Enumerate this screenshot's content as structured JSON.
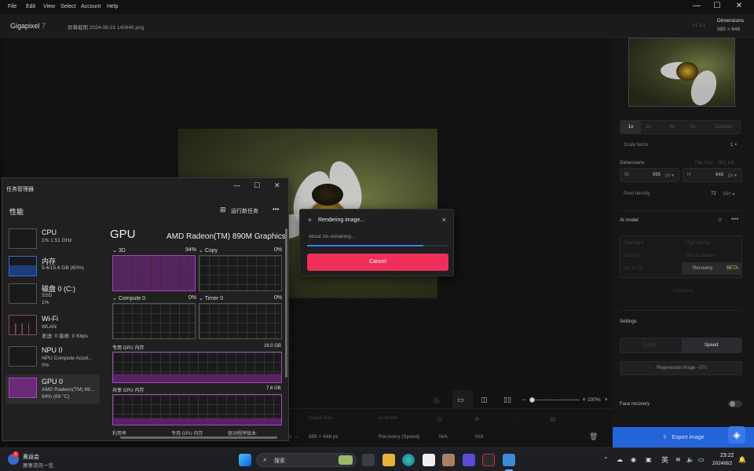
{
  "menu": [
    "File",
    "Edit",
    "View",
    "Select",
    "Account",
    "Help"
  ],
  "app": {
    "name": "Gigapixel",
    "version": "7",
    "filename": "屏幕截图 2024-08-01 140640.png",
    "build": "v7.3.1",
    "dimensions_label": "Dimensions",
    "dimensions_value": "995 × 648"
  },
  "scale": {
    "options": [
      "1x",
      "2x",
      "4x",
      "6x",
      "Custom"
    ],
    "factor_label": "Scale factor",
    "factor_value": "1 ×"
  },
  "dims": {
    "label": "Dimensions",
    "file_size": "File Size: ~991 KB",
    "w_label": "W",
    "w_value": "995",
    "w_unit": "px ▾",
    "h_label": "H",
    "h_value": "648",
    "h_unit": "px ▾",
    "density_label": "Pixel density",
    "density_value": "72",
    "density_unit": "PPI ▾"
  },
  "ai": {
    "label": "AI model",
    "models": [
      "Standard",
      "High fidelity",
      "Low res",
      "Text & shapes",
      "Art & CG",
      "Recovery"
    ],
    "badge": "BETA",
    "compare": "Compare"
  },
  "settings": {
    "label": "Settings",
    "quality": "Quality",
    "speed": "Speed",
    "regen": "Regenerate image ~57s",
    "face": "Face recovery"
  },
  "export": {
    "label": "Export image"
  },
  "zoom": "100%",
  "table": {
    "headers": [
      "Output Size",
      "AI Model"
    ],
    "in": "995 × 648 px",
    "sep": "x →",
    "out": "995 × 648 px",
    "model": "Recovery (Speed)",
    "na1": "N/A",
    "na2": "N/A"
  },
  "render": {
    "title": "Rendering image...",
    "remaining": "About 1m remaining...",
    "cancel": "Cancel",
    "progress": 0.82
  },
  "taskmgr": {
    "title": "任务管理器",
    "perf": "性能",
    "run": "运行新任务",
    "items": [
      {
        "name": "CPU",
        "sub1": "1%  1.51 GHz",
        "sub2": ""
      },
      {
        "name": "内存",
        "sub1": "9.4/15.6 GB (60%)",
        "sub2": ""
      },
      {
        "name": "磁盘 0 (C:)",
        "sub1": "SSD",
        "sub2": "1%"
      },
      {
        "name": "Wi-Fi",
        "sub1": "WLAN",
        "sub2": "发送: 0 接收: 0 Kbps"
      },
      {
        "name": "NPU 0",
        "sub1": "NPU Compute Accel...",
        "sub2": "0%"
      },
      {
        "name": "GPU 0",
        "sub1": "AMD Radeon(TM) 89...",
        "sub2": "94% (69 °C)"
      }
    ],
    "gpu_title": "GPU",
    "gpu_model": "AMD Radeon(TM) 890M Graphics",
    "g3d": "3D",
    "g3d_pct": "94%",
    "copy": "Copy",
    "copy_pct": "0%",
    "compute": "Compute 0",
    "compute_pct": "0%",
    "timer": "Timer 0",
    "timer_pct": "0%",
    "ded": "专用 GPU 内存",
    "ded_val": "16.0 GB",
    "shared": "共享 GPU 内存",
    "shared_val": "7.8 GB",
    "foot": [
      "利用率",
      "专用 GPU 内存",
      "驱动程序版本:"
    ]
  },
  "taskbar": {
    "news_title": "奥运会",
    "news_sub": "赛事资讯一览",
    "search": "搜索",
    "ime": "英",
    "time": "23:22",
    "date": "2024/8/2"
  }
}
